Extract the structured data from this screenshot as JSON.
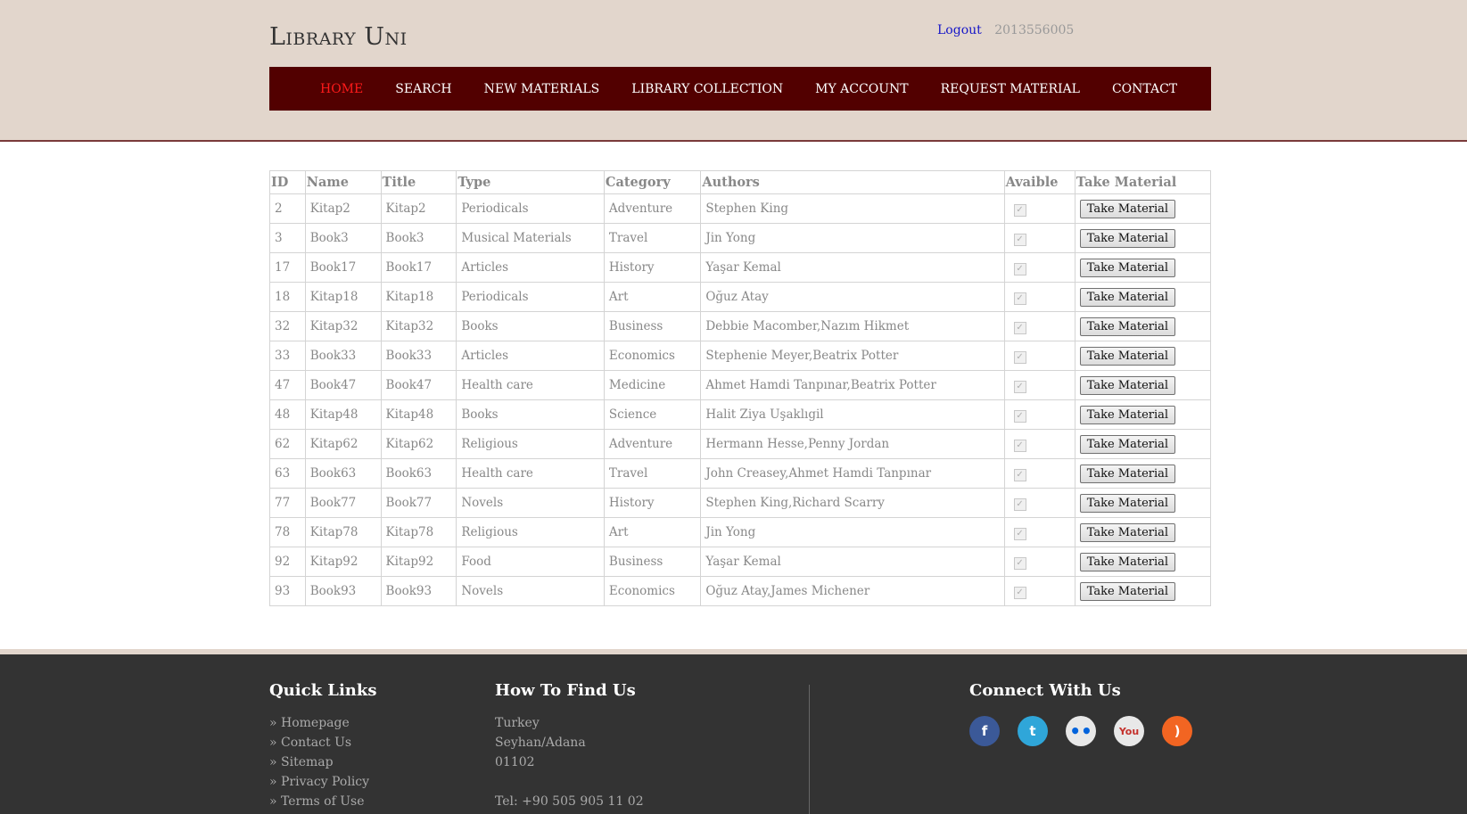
{
  "site": {
    "logo": "Library Uni",
    "logout_label": "Logout",
    "user_id": "2013556005"
  },
  "nav": [
    {
      "label": "HOME",
      "active": true
    },
    {
      "label": "SEARCH",
      "active": false
    },
    {
      "label": "NEW MATERIALS",
      "active": false
    },
    {
      "label": "LIBRARY COLLECTION",
      "active": false
    },
    {
      "label": "MY ACCOUNT",
      "active": false
    },
    {
      "label": "REQUEST MATERIAL",
      "active": false
    },
    {
      "label": "CONTACT",
      "active": false
    }
  ],
  "table": {
    "columns": [
      "ID",
      "Name",
      "Title",
      "Type",
      "Category",
      "Authors",
      "Avaible",
      "Take Material"
    ],
    "button_label": "Take Material",
    "rows": [
      {
        "id": "2",
        "name": "Kitap2",
        "title": "Kitap2",
        "type": "Periodicals",
        "category": "Adventure",
        "authors": "Stephen King",
        "available": true
      },
      {
        "id": "3",
        "name": "Book3",
        "title": "Book3",
        "type": "Musical Materials",
        "category": "Travel",
        "authors": "Jin Yong",
        "available": true
      },
      {
        "id": "17",
        "name": "Book17",
        "title": "Book17",
        "type": "Articles",
        "category": "History",
        "authors": "Yaşar Kemal",
        "available": true
      },
      {
        "id": "18",
        "name": "Kitap18",
        "title": "Kitap18",
        "type": "Periodicals",
        "category": "Art",
        "authors": "Oğuz Atay",
        "available": true
      },
      {
        "id": "32",
        "name": "Kitap32",
        "title": "Kitap32",
        "type": "Books",
        "category": "Business",
        "authors": "Debbie Macomber,Nazım Hikmet",
        "available": true
      },
      {
        "id": "33",
        "name": "Book33",
        "title": "Book33",
        "type": "Articles",
        "category": "Economics",
        "authors": "Stephenie Meyer,Beatrix Potter",
        "available": true
      },
      {
        "id": "47",
        "name": "Book47",
        "title": "Book47",
        "type": "Health care",
        "category": "Medicine",
        "authors": "Ahmet Hamdi Tanpınar,Beatrix Potter",
        "available": true
      },
      {
        "id": "48",
        "name": "Kitap48",
        "title": "Kitap48",
        "type": "Books",
        "category": "Science",
        "authors": "Halit Ziya Uşaklıgil",
        "available": true
      },
      {
        "id": "62",
        "name": "Kitap62",
        "title": "Kitap62",
        "type": "Religious",
        "category": "Adventure",
        "authors": "Hermann Hesse,Penny Jordan",
        "available": true
      },
      {
        "id": "63",
        "name": "Book63",
        "title": "Book63",
        "type": "Health care",
        "category": "Travel",
        "authors": "John Creasey,Ahmet Hamdi Tanpınar",
        "available": true
      },
      {
        "id": "77",
        "name": "Book77",
        "title": "Book77",
        "type": "Novels",
        "category": "History",
        "authors": "Stephen King,Richard Scarry",
        "available": true
      },
      {
        "id": "78",
        "name": "Kitap78",
        "title": "Kitap78",
        "type": "Religious",
        "category": "Art",
        "authors": "Jin Yong",
        "available": true
      },
      {
        "id": "92",
        "name": "Kitap92",
        "title": "Kitap92",
        "type": "Food",
        "category": "Business",
        "authors": "Yaşar Kemal",
        "available": true
      },
      {
        "id": "93",
        "name": "Book93",
        "title": "Book93",
        "type": "Novels",
        "category": "Economics",
        "authors": "Oğuz Atay,James Michener",
        "available": true
      }
    ]
  },
  "footer": {
    "quick_links_title": "Quick Links",
    "quick_links": [
      "» Homepage",
      "» Contact Us",
      "» Sitemap",
      "» Privacy Policy",
      "» Terms of Use"
    ],
    "find_us_title": "How To Find Us",
    "address": [
      "Turkey",
      "Seyhan/Adana",
      "01102",
      "",
      "Tel: +90 505 905 11 02"
    ],
    "connect_title": "Connect With Us",
    "social": [
      {
        "icon": "facebook-icon",
        "glyph": "f",
        "color": "#3b5998"
      },
      {
        "icon": "twitter-icon",
        "glyph": "t",
        "color": "#2fa6d9"
      },
      {
        "icon": "flickr-icon",
        "glyph": "••",
        "color": "#e8e8e8"
      },
      {
        "icon": "youtube-icon",
        "glyph": "You",
        "color": "#e8e8e8"
      },
      {
        "icon": "rss-icon",
        "glyph": ")",
        "color": "#f26522"
      }
    ]
  }
}
